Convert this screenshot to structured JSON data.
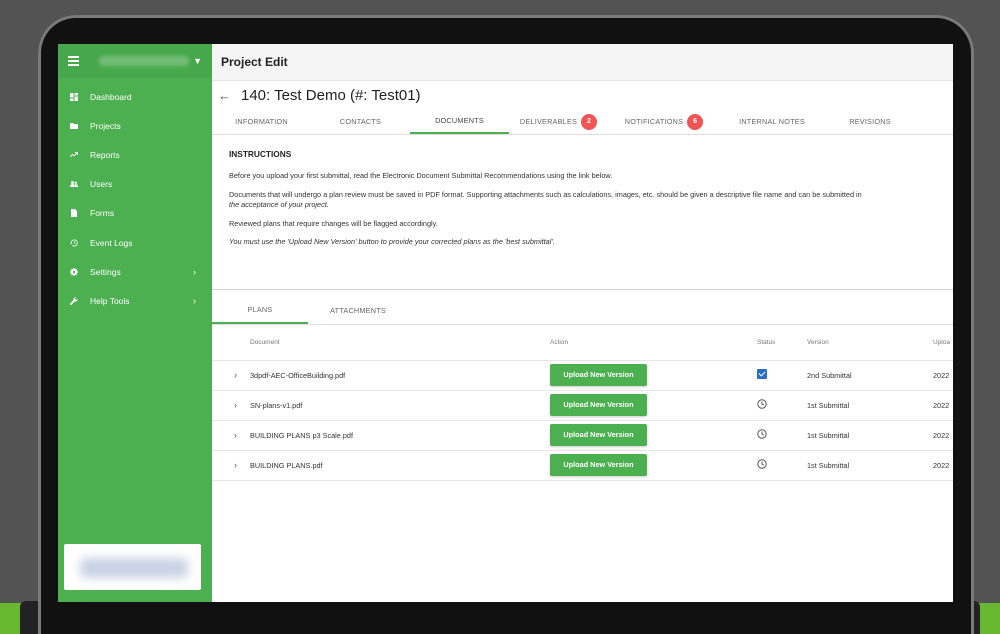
{
  "header": {
    "title": "Project Edit"
  },
  "project": {
    "title": "140: Test Demo (#: Test01)"
  },
  "sidebar": {
    "items": [
      {
        "label": "Dashboard",
        "icon": "dashboard-icon"
      },
      {
        "label": "Projects",
        "icon": "folder-icon"
      },
      {
        "label": "Reports",
        "icon": "trend-icon"
      },
      {
        "label": "Users",
        "icon": "users-icon"
      },
      {
        "label": "Forms",
        "icon": "file-icon"
      },
      {
        "label": "Event Logs",
        "icon": "history-icon"
      },
      {
        "label": "Settings",
        "icon": "gear-icon"
      },
      {
        "label": "Help Tools",
        "icon": "wrench-icon"
      }
    ]
  },
  "tabs": [
    {
      "label": "INFORMATION"
    },
    {
      "label": "CONTACTS"
    },
    {
      "label": "DOCUMENTS"
    },
    {
      "label": "DELIVERABLES",
      "badge": "2"
    },
    {
      "label": "NOTIFICATIONS",
      "badge": "6"
    },
    {
      "label": "INTERNAL NOTES"
    },
    {
      "label": "REVISIONS"
    }
  ],
  "instructions": {
    "heading": "INSTRUCTIONS",
    "p1": "Before you upload your first submittal, read the Electronic Document Submittal Recommendations using the link below.",
    "p2a": "Documents that will undergo a plan review must be saved in PDF format. Supporting attachments such as calculations, images, etc. should be given a descriptive file name and can be submitted in",
    "p2b": "the acceptance of your project.",
    "p3": "Reviewed plans that require changes will be flagged accordingly.",
    "p4": "You must use the 'Upload New Version' button to provide your corrected plans as the 'best submittal'."
  },
  "subtabs": [
    {
      "label": "PLANS"
    },
    {
      "label": "ATTACHMENTS"
    }
  ],
  "table": {
    "headers": {
      "document": "Document",
      "action": "Action",
      "status": "Status",
      "version": "Version",
      "upload": "Uploa"
    },
    "rows": [
      {
        "document": "3dpdf-AEC-OfficeBuilding.pdf",
        "action": "Upload New Version",
        "status": "check",
        "version": "2nd Submittal",
        "upload": "2022"
      },
      {
        "document": "SN-plans-v1.pdf",
        "action": "Upload New Version",
        "status": "clock",
        "version": "1st Submittal",
        "upload": "2022"
      },
      {
        "document": "BUILDING PLANS p3 Scale.pdf",
        "action": "Upload New Version",
        "status": "clock",
        "version": "1st Submittal",
        "upload": "2022"
      },
      {
        "document": "BUILDING PLANS.pdf",
        "action": "Upload New Version",
        "status": "clock",
        "version": "1st Submittal",
        "upload": "2022"
      }
    ]
  },
  "colors": {
    "sidebar": "#4caf50",
    "accent": "#4caf50",
    "badge": "#f05454",
    "checkbox": "#2a6dc9"
  }
}
